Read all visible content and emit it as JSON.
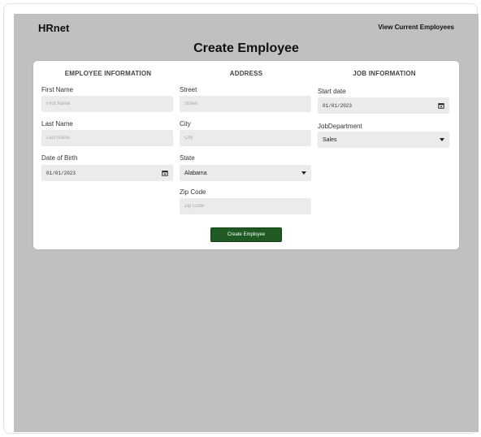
{
  "header": {
    "brand": "HRnet",
    "nav_link": "View Current Employees"
  },
  "page": {
    "title": "Create Employee"
  },
  "sections": {
    "employee": {
      "title": "EMPLOYEE INFORMATION",
      "first_name": {
        "label": "First Name",
        "placeholder": "First Name"
      },
      "last_name": {
        "label": "Last Name",
        "placeholder": "Last Name"
      },
      "birth": {
        "label": "Date of Birth",
        "value": "01/01/2023"
      }
    },
    "address": {
      "title": "ADDRESS",
      "street": {
        "label": "Street",
        "placeholder": "Street"
      },
      "city": {
        "label": "City",
        "placeholder": "City"
      },
      "state": {
        "label": "State",
        "value": "Alabama"
      },
      "zip": {
        "label": "Zip Code",
        "placeholder": "Zip Code"
      }
    },
    "job": {
      "title": "JOB INFORMATION",
      "start": {
        "label": "Start date",
        "value": "01/01/2023"
      },
      "department": {
        "label": "JobDepartment",
        "value": "Sales"
      }
    }
  },
  "form": {
    "submit_label": "Create Employee"
  },
  "colors": {
    "background": "#c0c0c0",
    "card": "#ffffff",
    "input": "#ebebeb",
    "button": "#1e5a22"
  },
  "icons": {
    "date": "calendar-icon",
    "select": "caret-down-icon"
  }
}
